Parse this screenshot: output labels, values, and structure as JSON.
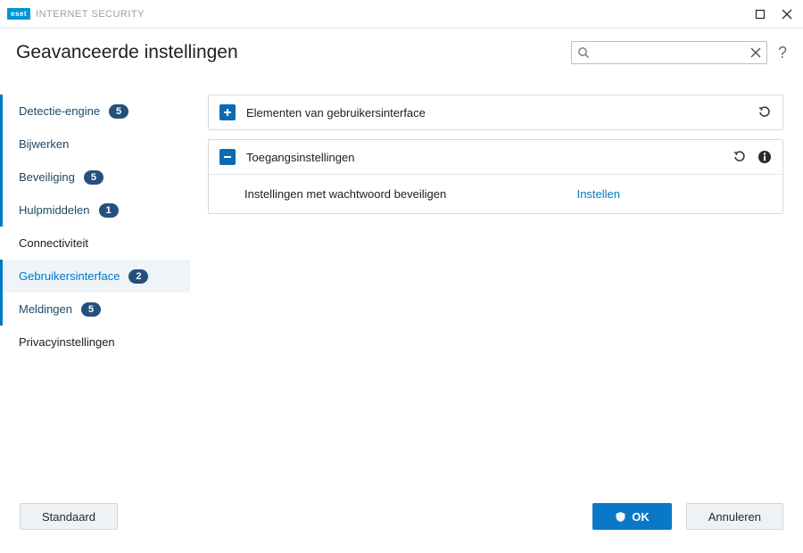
{
  "title_bar": {
    "brand": "eset",
    "product": "INTERNET SECURITY"
  },
  "header": {
    "page_title": "Geavanceerde instellingen",
    "search_placeholder": "",
    "search_value": "",
    "help_label": "?"
  },
  "sidebar": {
    "items": [
      {
        "label": "Detectie-engine",
        "badge": "5"
      },
      {
        "label": "Bijwerken",
        "badge": null
      },
      {
        "label": "Beveiliging",
        "badge": "5"
      },
      {
        "label": "Hulpmiddelen",
        "badge": "1"
      },
      {
        "label": "Connectiviteit",
        "badge": null
      },
      {
        "label": "Gebruikersinterface",
        "badge": "2"
      },
      {
        "label": "Meldingen",
        "badge": "5"
      },
      {
        "label": "Privacyinstellingen",
        "badge": null
      }
    ],
    "active_index": 5
  },
  "panels": [
    {
      "title": "Elementen van gebruikersinterface",
      "expanded": false
    },
    {
      "title": "Toegangsinstellingen",
      "expanded": true,
      "rows": [
        {
          "label": "Instellingen met wachtwoord beveiligen",
          "action": "Instellen"
        }
      ]
    }
  ],
  "footer": {
    "default_label": "Standaard",
    "ok_label": "OK",
    "cancel_label": "Annuleren"
  }
}
